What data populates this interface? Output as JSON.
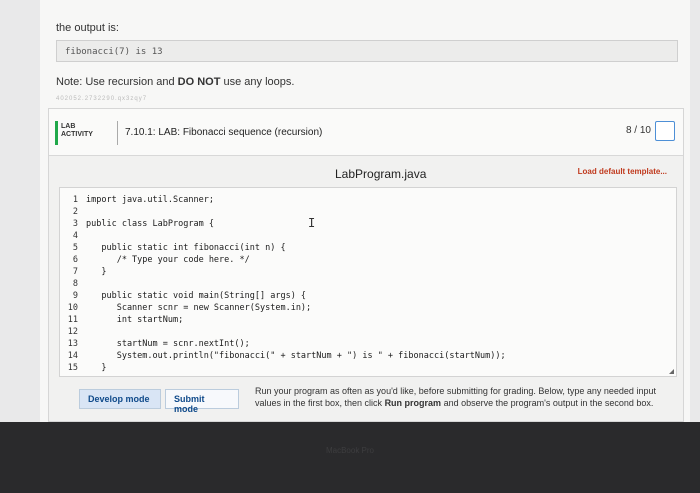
{
  "output_label": "the output is:",
  "output_value": "fibonacci(7) is 13",
  "note": {
    "prefix": "Note: Use recursion and ",
    "bold": "DO NOT",
    "suffix": " use any loops."
  },
  "tiny_id": "402052.2732290.qx3zqy7",
  "lab": {
    "badge_line1": "LAB",
    "badge_line2": "ACTIVITY",
    "title": "7.10.1: LAB: Fibonacci sequence (recursion)",
    "score": "8 / 10"
  },
  "editor": {
    "file_name": "LabProgram.java",
    "load_template": "Load default template..."
  },
  "code": {
    "line_numbers": [
      "1",
      "2",
      "3",
      "4",
      "5",
      "6",
      "7",
      "8",
      "9",
      "10",
      "11",
      "12",
      "13",
      "14",
      "15"
    ],
    "lines": [
      "import java.util.Scanner;",
      "",
      "public class LabProgram {",
      "",
      "   public static int fibonacci(int n) {",
      "      /* Type your code here. */",
      "   }",
      "",
      "   public static void main(String[] args) {",
      "      Scanner scnr = new Scanner(System.in);",
      "      int startNum;",
      "",
      "      startNum = scnr.nextInt();",
      "      System.out.println(\"fibonacci(\" + startNum + \") is \" + fibonacci(startNum));",
      "   }"
    ]
  },
  "buttons": {
    "develop": "Develop mode",
    "submit": "Submit mode"
  },
  "help": {
    "part1": "Run your program as often as you'd like, before submitting for grading. Below, type any needed input values in the first box, then click ",
    "bold": "Run program",
    "part2": " and observe the program's output in the second box."
  },
  "bezel": "MacBook Pro"
}
